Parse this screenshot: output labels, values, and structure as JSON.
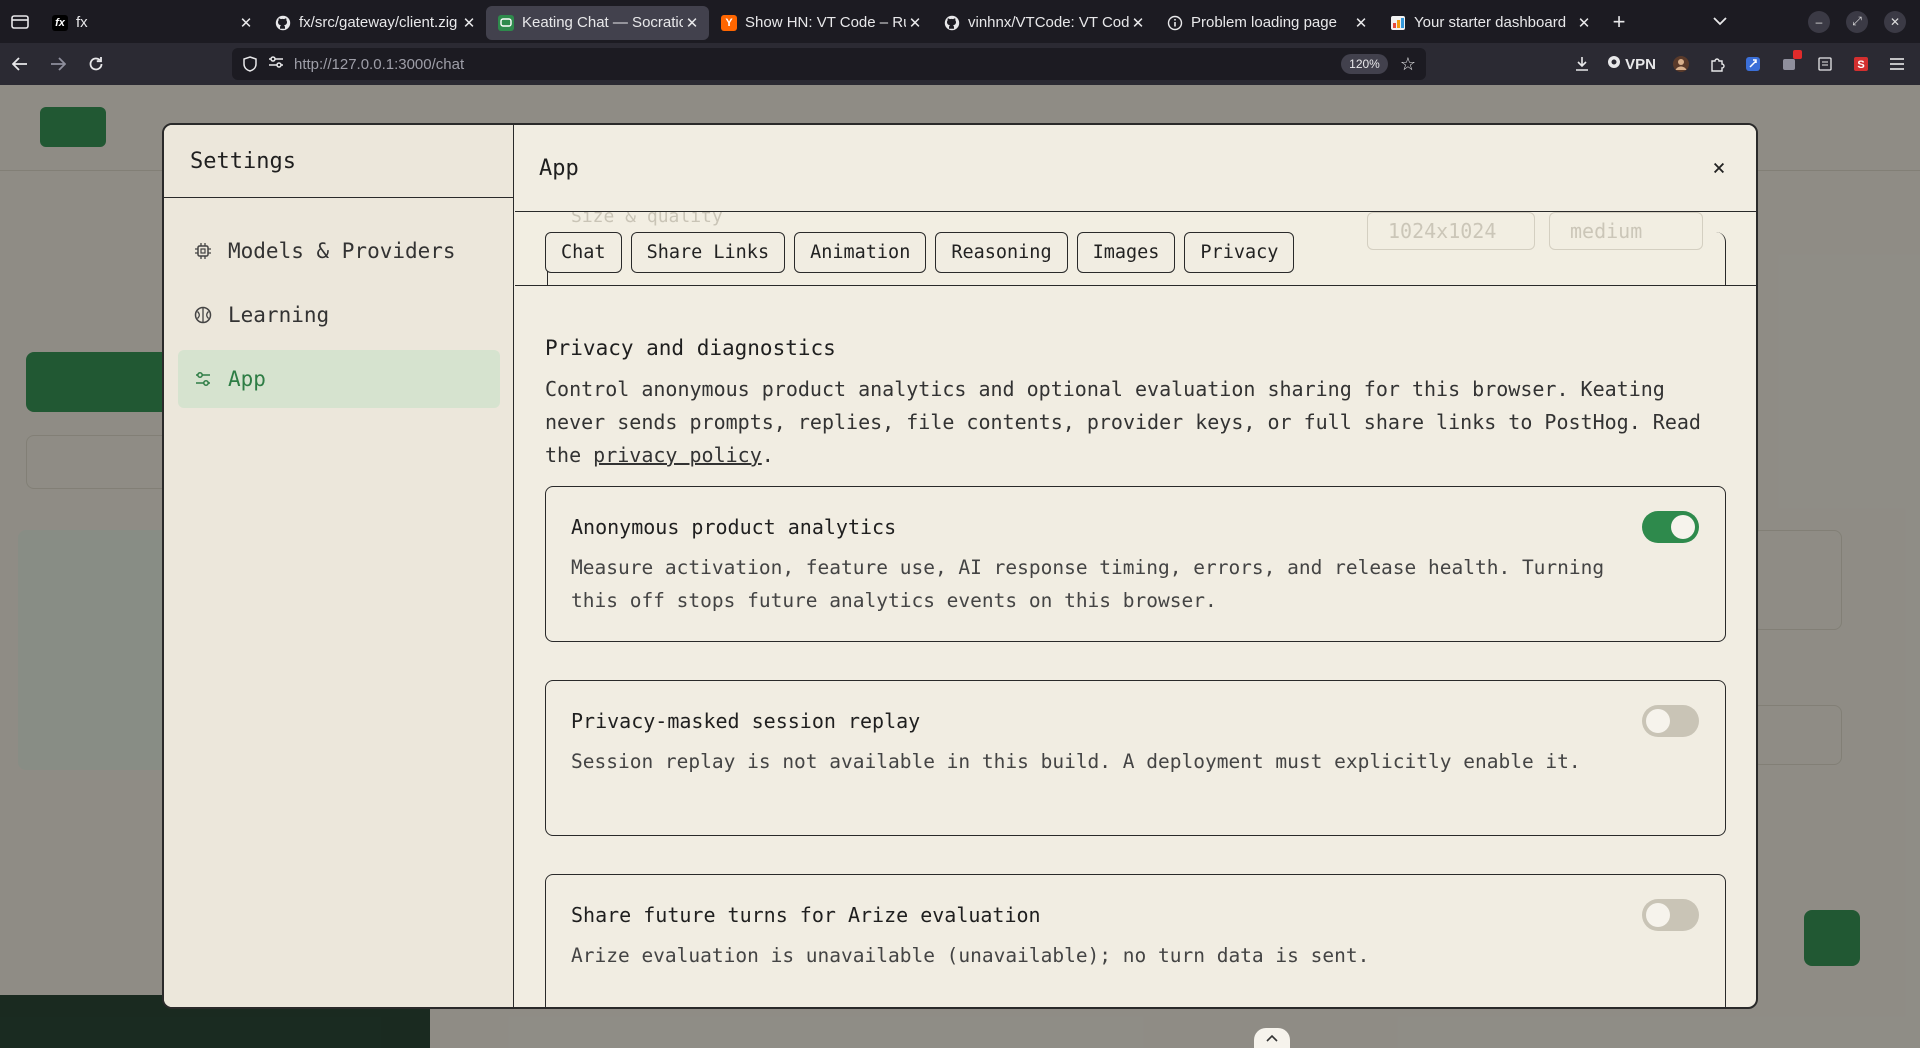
{
  "browser": {
    "tabs": [
      {
        "title": "fx",
        "favicon": "fx",
        "favicon_bg": "#000000",
        "favicon_color": "#ffffff",
        "active": false
      },
      {
        "title": "fx/src/gateway/client.zig",
        "favicon": "github",
        "favicon_bg": "#1c1b22",
        "favicon_color": "#ffffff",
        "active": false
      },
      {
        "title": "Keating Chat — Socratic",
        "favicon": "keating",
        "favicon_bg": "#2e8a4c",
        "favicon_color": "#ffffff",
        "active": true
      },
      {
        "title": "Show HN: VT Code – Rust",
        "favicon": "Y",
        "favicon_bg": "#ff6600",
        "favicon_color": "#ffffff",
        "active": false
      },
      {
        "title": "vinhnx/VTCode: VT Code",
        "favicon": "github",
        "favicon_bg": "#1c1b22",
        "favicon_color": "#ffffff",
        "active": false
      },
      {
        "title": "Problem loading page",
        "favicon": "info",
        "favicon_bg": "#1c1b22",
        "favicon_color": "#ffffff",
        "active": false
      },
      {
        "title": "Your starter dashboard",
        "favicon": "dashboard",
        "favicon_bg": "#e8e8ea",
        "favicon_color": "#c0392b",
        "active": false
      }
    ],
    "url": "http://127.0.0.1:3000/chat",
    "zoom": "120%",
    "vpn_label": "VPN"
  },
  "settings": {
    "sidebar_title": "Settings",
    "nav": [
      {
        "label": "Models & Providers",
        "icon": "chip-icon",
        "active": false
      },
      {
        "label": "Learning",
        "icon": "learning-icon",
        "active": false
      },
      {
        "label": "App",
        "icon": "sliders-icon",
        "active": true
      }
    ],
    "header_title": "App",
    "close_label": "×",
    "ghost": {
      "label": "Size & quality",
      "size_value": "1024x1024",
      "quality_value": "medium"
    },
    "tabs": [
      "Chat",
      "Share Links",
      "Animation",
      "Reasoning",
      "Images",
      "Privacy"
    ],
    "privacy": {
      "title": "Privacy and diagnostics",
      "desc_before": "Control anonymous product analytics and optional evaluation sharing for this browser. Keating never sends prompts, replies, file contents, provider keys, or full share links to PostHog. Read the ",
      "link_text": "privacy policy",
      "desc_after": "."
    },
    "cards": [
      {
        "title": "Anonymous product analytics",
        "desc": "Measure activation, feature use, AI response timing, errors, and release health. Turning this off stops future analytics events on this browser.",
        "enabled": true
      },
      {
        "title": "Privacy-masked session replay",
        "desc": "Session replay is not available in this build. A deployment must explicitly enable it.",
        "enabled": false
      },
      {
        "title": "Share future turns for Arize evaluation",
        "desc": "Arize evaluation is unavailable (unavailable); no turn data is sent.",
        "enabled": false
      }
    ]
  },
  "colors": {
    "accent_green": "#2e8a4c",
    "modal_bg": "#f1ede2",
    "active_nav_bg": "#d6e3cf"
  }
}
